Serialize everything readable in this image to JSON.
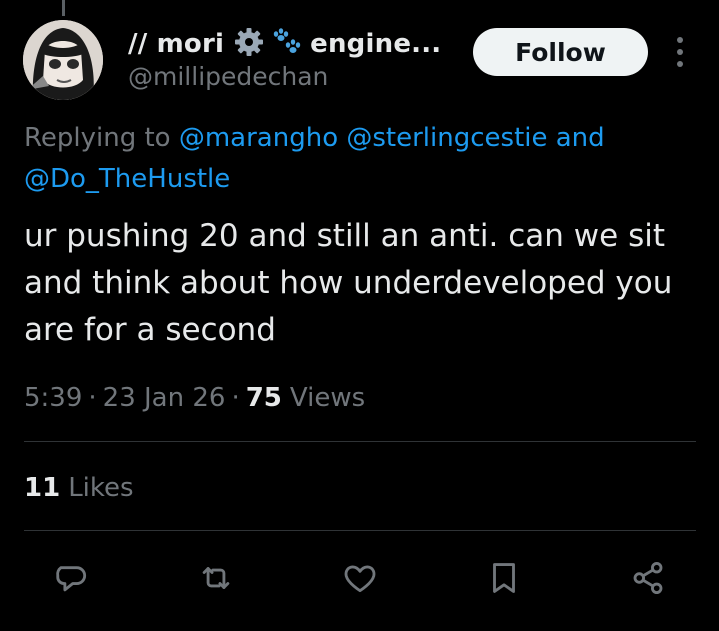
{
  "tweet": {
    "author": {
      "name": "// mori",
      "name_suffix": "engine...",
      "handle": "@millipedechan",
      "badges": [
        "gear-emoji",
        "paw-prints-emoji"
      ]
    },
    "follow_label": "Follow",
    "reply_prefix": "Replying to",
    "reply_mentions": [
      "@marangho",
      "@sterlingcestie"
    ],
    "reply_and": "and",
    "reply_last_mention": "@Do_TheHustle",
    "text": "ur pushing 20 and still an anti. can we sit and think about how underdeveloped you are for a second",
    "time": "5:39",
    "date": "23 Jan 26",
    "views_count": "75",
    "views_label": "Views",
    "likes_count": "11",
    "likes_label": "Likes"
  },
  "actions": [
    {
      "icon": "reply-icon"
    },
    {
      "icon": "retweet-icon"
    },
    {
      "icon": "like-icon"
    },
    {
      "icon": "bookmark-icon"
    },
    {
      "icon": "share-icon"
    }
  ],
  "colors": {
    "background": "#000000",
    "text": "#e7e9ea",
    "muted": "#71767b",
    "link": "#1d9bf0",
    "divider": "#2f3336",
    "button_bg": "#eff3f4"
  }
}
